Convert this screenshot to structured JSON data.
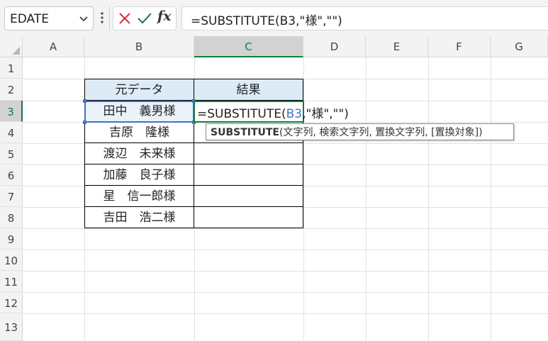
{
  "formula_bar": {
    "name_box": "EDATE",
    "formula": "=SUBSTITUTE(B3,\"様\",\"\")"
  },
  "icons": {
    "name_box_dropdown": "chevron-down-icon",
    "more": "vertical-ellipsis-icon",
    "cancel": "x-icon",
    "enter": "checkmark-icon",
    "insert_function": "fx-icon"
  },
  "insert_function_label": "fx",
  "columns": [
    "A",
    "B",
    "C",
    "D",
    "E",
    "F",
    "G"
  ],
  "rows": [
    "1",
    "2",
    "3",
    "4",
    "5",
    "6",
    "7",
    "8",
    "9",
    "10",
    "11",
    "12",
    "13"
  ],
  "table": {
    "headers": [
      "元データ",
      "結果"
    ],
    "b_values": [
      "田中　義男様",
      "吉原　隆様",
      "渡辺　未来様",
      "加藤　良子様",
      "星　信一郎様",
      "吉田　浩二様"
    ]
  },
  "editing": {
    "prefix": "=SUBSTITUTE(",
    "ref": "B3",
    "suffix": ",\"様\",\"\")"
  },
  "tooltip": {
    "function": "SUBSTITUTE",
    "args": "(文字列, 検索文字列, 置換文字列, [置換対象])"
  },
  "colors": {
    "accent_green": "#107c41",
    "reference_blue": "#4472c4",
    "header_fill": "#ddebf7"
  }
}
